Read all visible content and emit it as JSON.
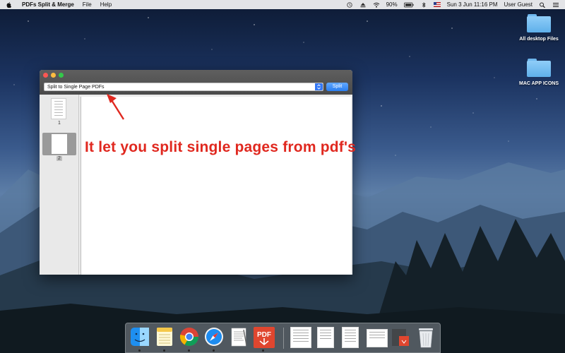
{
  "menubar": {
    "app_name": "PDFs Split & Merge",
    "menu_file": "File",
    "menu_help": "Help",
    "battery": "90%",
    "datetime": "Sun 3 Jun  11:16 PM",
    "user": "User Guest"
  },
  "desktop": {
    "icons": [
      {
        "label": "All desktop Files",
        "icon": "folder-icon"
      },
      {
        "label": "MAC APP ICONS",
        "icon": "folder-icon"
      }
    ]
  },
  "window": {
    "mode_selected": "Split to Single Page PDFs",
    "split_label": "Split",
    "pages": [
      {
        "number": "1"
      },
      {
        "number": "2"
      }
    ]
  },
  "annotation": {
    "text": "It let you split single pages from pdf's",
    "color": "#e0281f"
  },
  "dock": {
    "apps": [
      "finder-icon",
      "notes-icon",
      "chrome-icon",
      "safari-icon",
      "textedit-icon",
      "pdf-split-merge-icon",
      "document-icon",
      "document-icon",
      "document-icon",
      "preview-icon",
      "pdf-file-icon",
      "trash-icon"
    ],
    "pdf_label": "PDF"
  },
  "colors": {
    "accent": "#3478f6",
    "window_titlebar": "#4a4a4a"
  }
}
